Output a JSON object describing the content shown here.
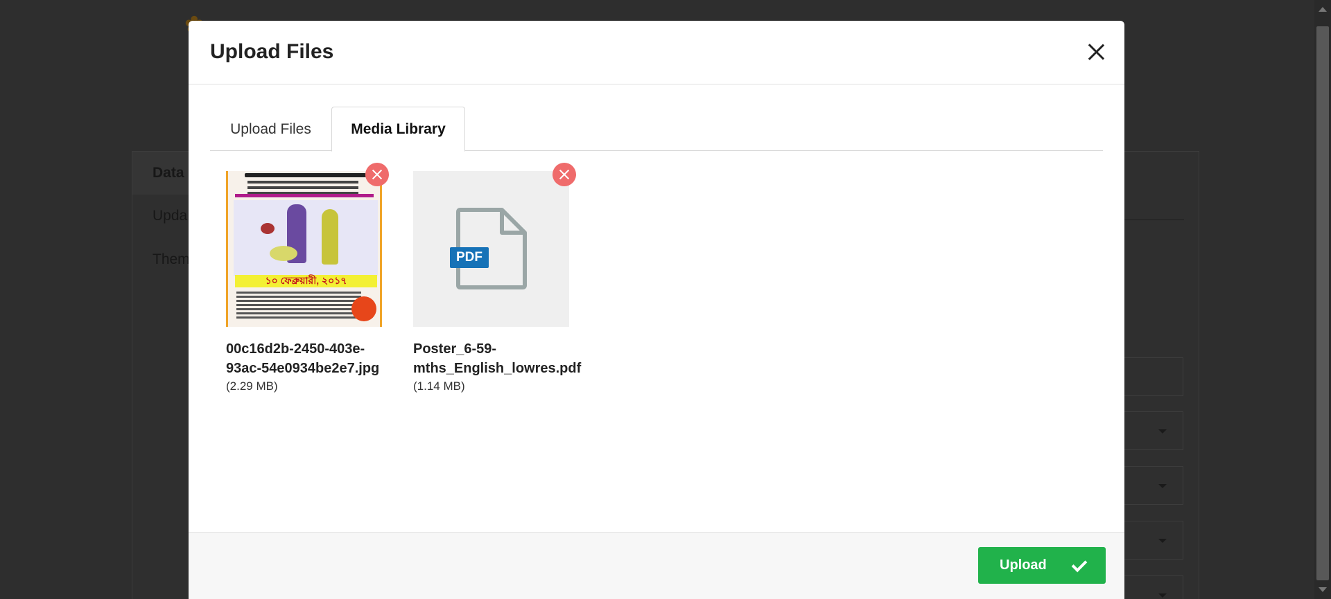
{
  "background": {
    "tab_label": "Data",
    "item_1": "Upda",
    "item_2": "Them"
  },
  "modal": {
    "title": "Upload Files",
    "tabs": [
      {
        "label": "Upload Files",
        "active": false
      },
      {
        "label": "Media Library",
        "active": true
      }
    ],
    "files": [
      {
        "name": "00c16d2b-2450-403e-93ac-54e0934be2e7.jpg",
        "size": "(2.29 MB)",
        "type": "image",
        "poster_band_text": "১০ ফেব্রুয়ারী, ২০১৭"
      },
      {
        "name": "Poster_6-59-mths_English_lowres.pdf",
        "size": "(1.14 MB)",
        "type": "pdf",
        "badge": "PDF"
      }
    ],
    "footer": {
      "upload_label": "Upload"
    }
  },
  "colors": {
    "upload_button": "#21b24b",
    "remove_button": "#ef6b6b",
    "pdf_badge": "#1672b7"
  }
}
